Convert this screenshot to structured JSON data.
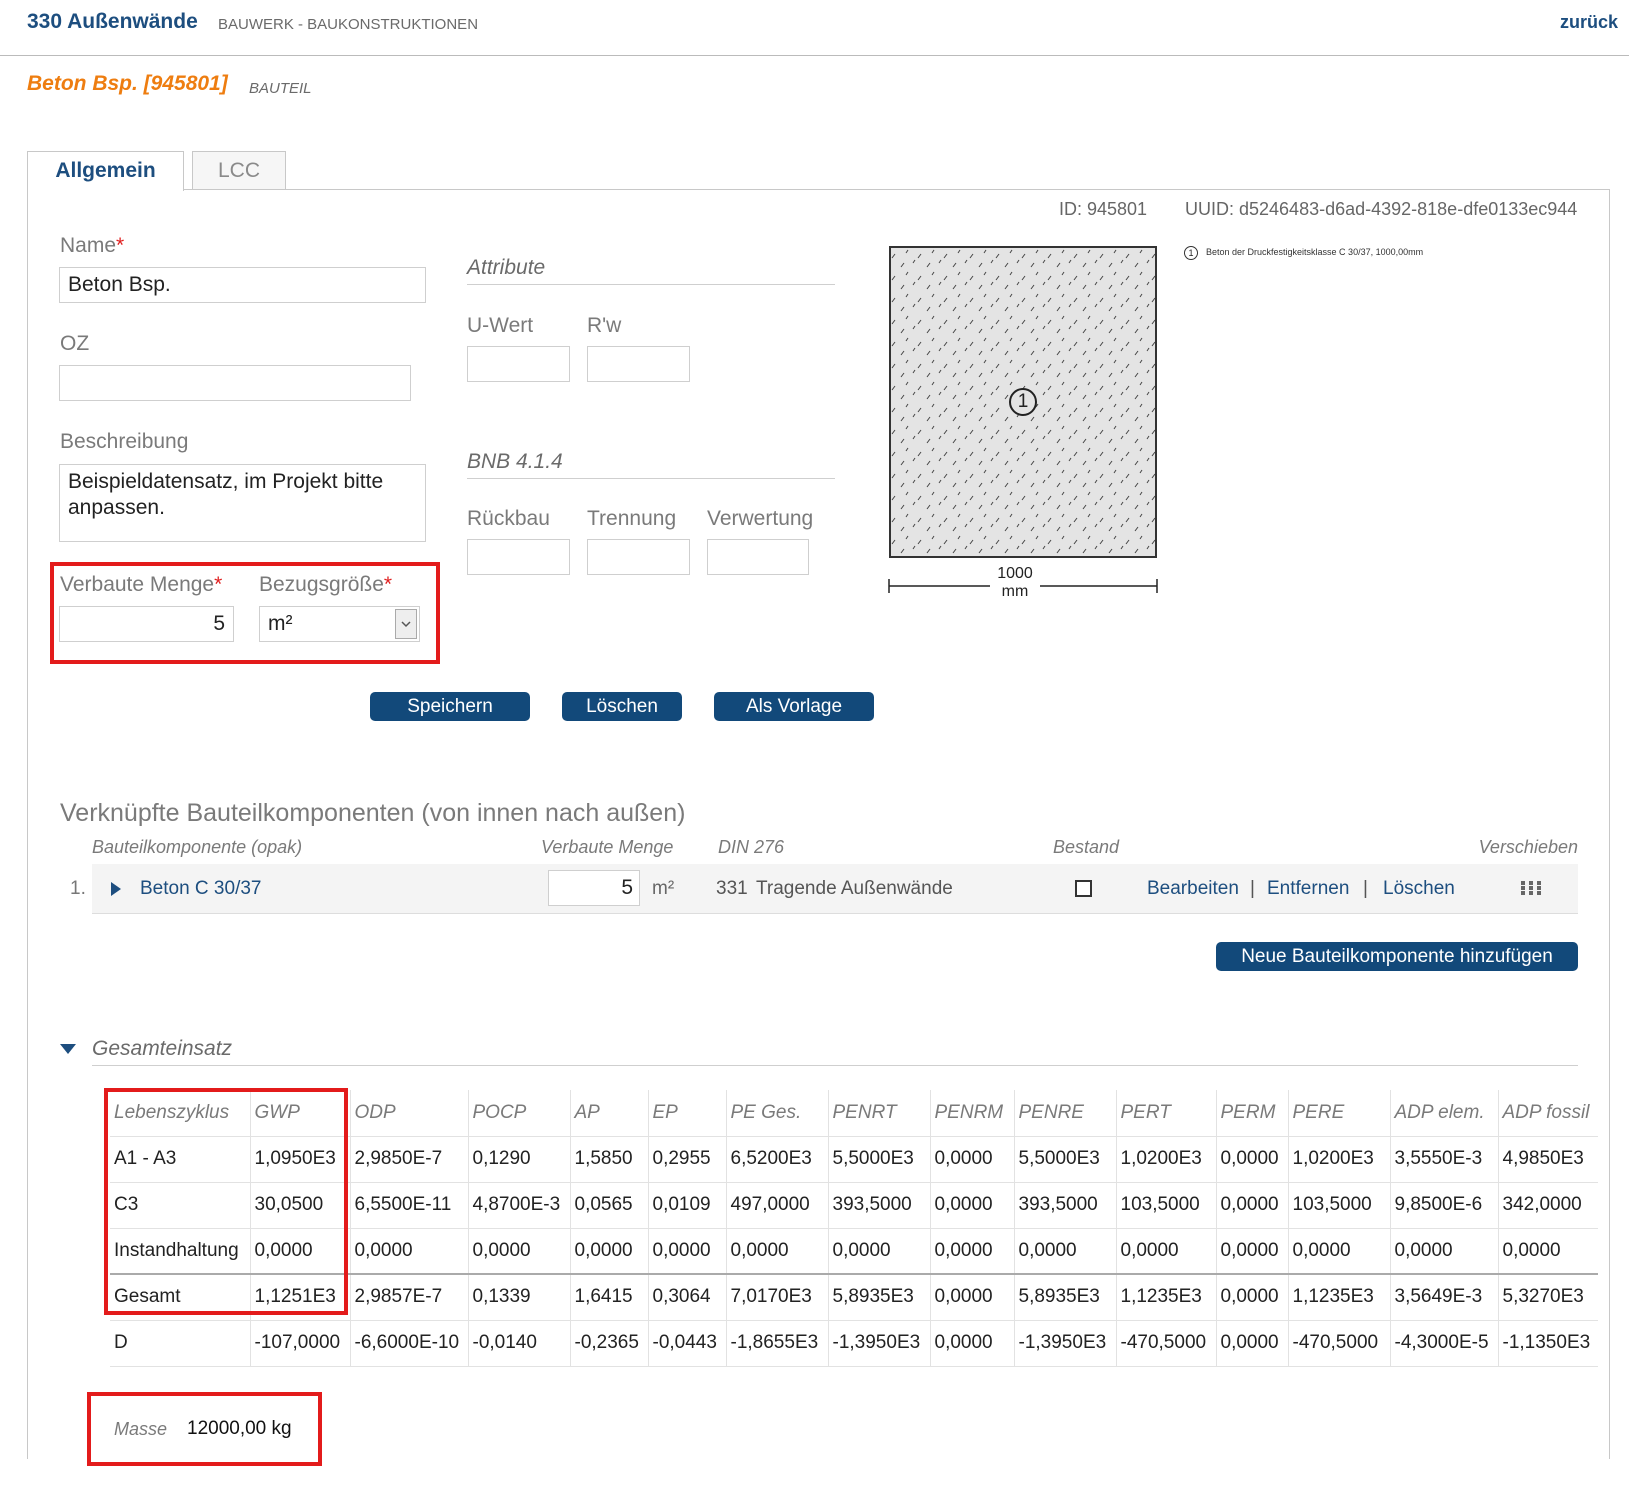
{
  "header": {
    "title": "330 Außenwände",
    "subtitle": "BAUWERK - BAUKONSTRUKTIONEN",
    "back": "zurück"
  },
  "bauteil": {
    "name": "Beton Bsp. [945801]",
    "type": "BAUTEIL"
  },
  "tabs": [
    {
      "label": "Allgemein"
    },
    {
      "label": "LCC"
    }
  ],
  "ids": {
    "id": "ID: 945801",
    "uuid": "UUID: d5246483-d6ad-4392-818e-dfe0133ec944"
  },
  "form": {
    "name_label": "Name",
    "name_value": "Beton Bsp.",
    "oz_label": "OZ",
    "oz_value": "",
    "description_label": "Beschreibung",
    "description_value": "Beispieldatensatz, im Projekt bitte anpassen.",
    "quantity_label": "Verbaute Menge",
    "quantity_value": "5",
    "reference_label": "Bezugsgröße",
    "reference_value": "m²",
    "required_mark": "*"
  },
  "attribute": {
    "title": "Attribute",
    "u_label": "U-Wert",
    "rw_label": "R'w"
  },
  "bnb": {
    "title": "BNB 4.1.4",
    "rueckbau_label": "Rückbau",
    "trennung_label": "Trennung",
    "verwertung_label": "Verwertung"
  },
  "drawing": {
    "layer_number": "1",
    "dimension_value": "1000",
    "dimension_unit": "mm",
    "legend": "Beton der Druckfestigkeitsklasse C 30/37, 1000,00mm",
    "fill_color": "#e4e4e4"
  },
  "buttons": {
    "save": "Speichern",
    "delete": "Löschen",
    "template": "Als Vorlage"
  },
  "components": {
    "title": "Verknüpfte Bauteilkomponenten (von innen nach außen)",
    "headers": {
      "component": "Bauteilkomponente (opak)",
      "quantity": "Verbaute Menge",
      "din": "DIN 276",
      "stock": "Bestand",
      "move": "Verschieben"
    },
    "rows": [
      {
        "index": "1.",
        "name": "Beton C 30/37",
        "quantity": "5",
        "unit": "m²",
        "din_code": "331",
        "din_name": "Tragende Außenwände",
        "edit": "Bearbeiten",
        "remove": "Entfernen",
        "delete": "Löschen",
        "separator": "|"
      }
    ],
    "add_button": "Neue Bauteilkomponente hinzufügen"
  },
  "totals": {
    "title": "Gesamteinsatz",
    "columns": [
      "Lebenszyklus",
      "GWP",
      "ODP",
      "POCP",
      "AP",
      "EP",
      "PE Ges.",
      "PENRT",
      "PENRM",
      "PENRE",
      "PERT",
      "PERM",
      "PERE",
      "ADP elem.",
      "ADP fossil"
    ],
    "rows": [
      [
        "A1 - A3",
        "1,0950E3",
        "2,9850E-7",
        "0,1290",
        "1,5850",
        "0,2955",
        "6,5200E3",
        "5,5000E3",
        "0,0000",
        "5,5000E3",
        "1,0200E3",
        "0,0000",
        "1,0200E3",
        "3,5550E-3",
        "4,9850E3"
      ],
      [
        "C3",
        "30,0500",
        "6,5500E-11",
        "4,8700E-3",
        "0,0565",
        "0,0109",
        "497,0000",
        "393,5000",
        "0,0000",
        "393,5000",
        "103,5000",
        "0,0000",
        "103,5000",
        "9,8500E-6",
        "342,0000"
      ],
      [
        "Instandhaltung",
        "0,0000",
        "0,0000",
        "0,0000",
        "0,0000",
        "0,0000",
        "0,0000",
        "0,0000",
        "0,0000",
        "0,0000",
        "0,0000",
        "0,0000",
        "0,0000",
        "0,0000",
        "0,0000"
      ],
      [
        "Gesamt",
        "1,1251E3",
        "2,9857E-7",
        "0,1339",
        "1,6415",
        "0,3064",
        "7,0170E3",
        "5,8935E3",
        "0,0000",
        "5,8935E3",
        "1,1235E3",
        "0,0000",
        "1,1235E3",
        "3,5649E-3",
        "5,3270E3"
      ],
      [
        "D",
        "-107,0000",
        "-6,6000E-10",
        "-0,0140",
        "-0,2365",
        "-0,0443",
        "-1,8655E3",
        "-1,3950E3",
        "0,0000",
        "-1,3950E3",
        "-470,5000",
        "0,0000",
        "-470,5000",
        "-4,3000E-5",
        "-1,1350E3"
      ]
    ],
    "mass_label": "Masse",
    "mass_value": "12000,00 kg"
  },
  "colors": {
    "primary": "#12497a",
    "link": "#1d4e7f",
    "accent": "#ee7d10",
    "highlight": "#e31b1b"
  }
}
